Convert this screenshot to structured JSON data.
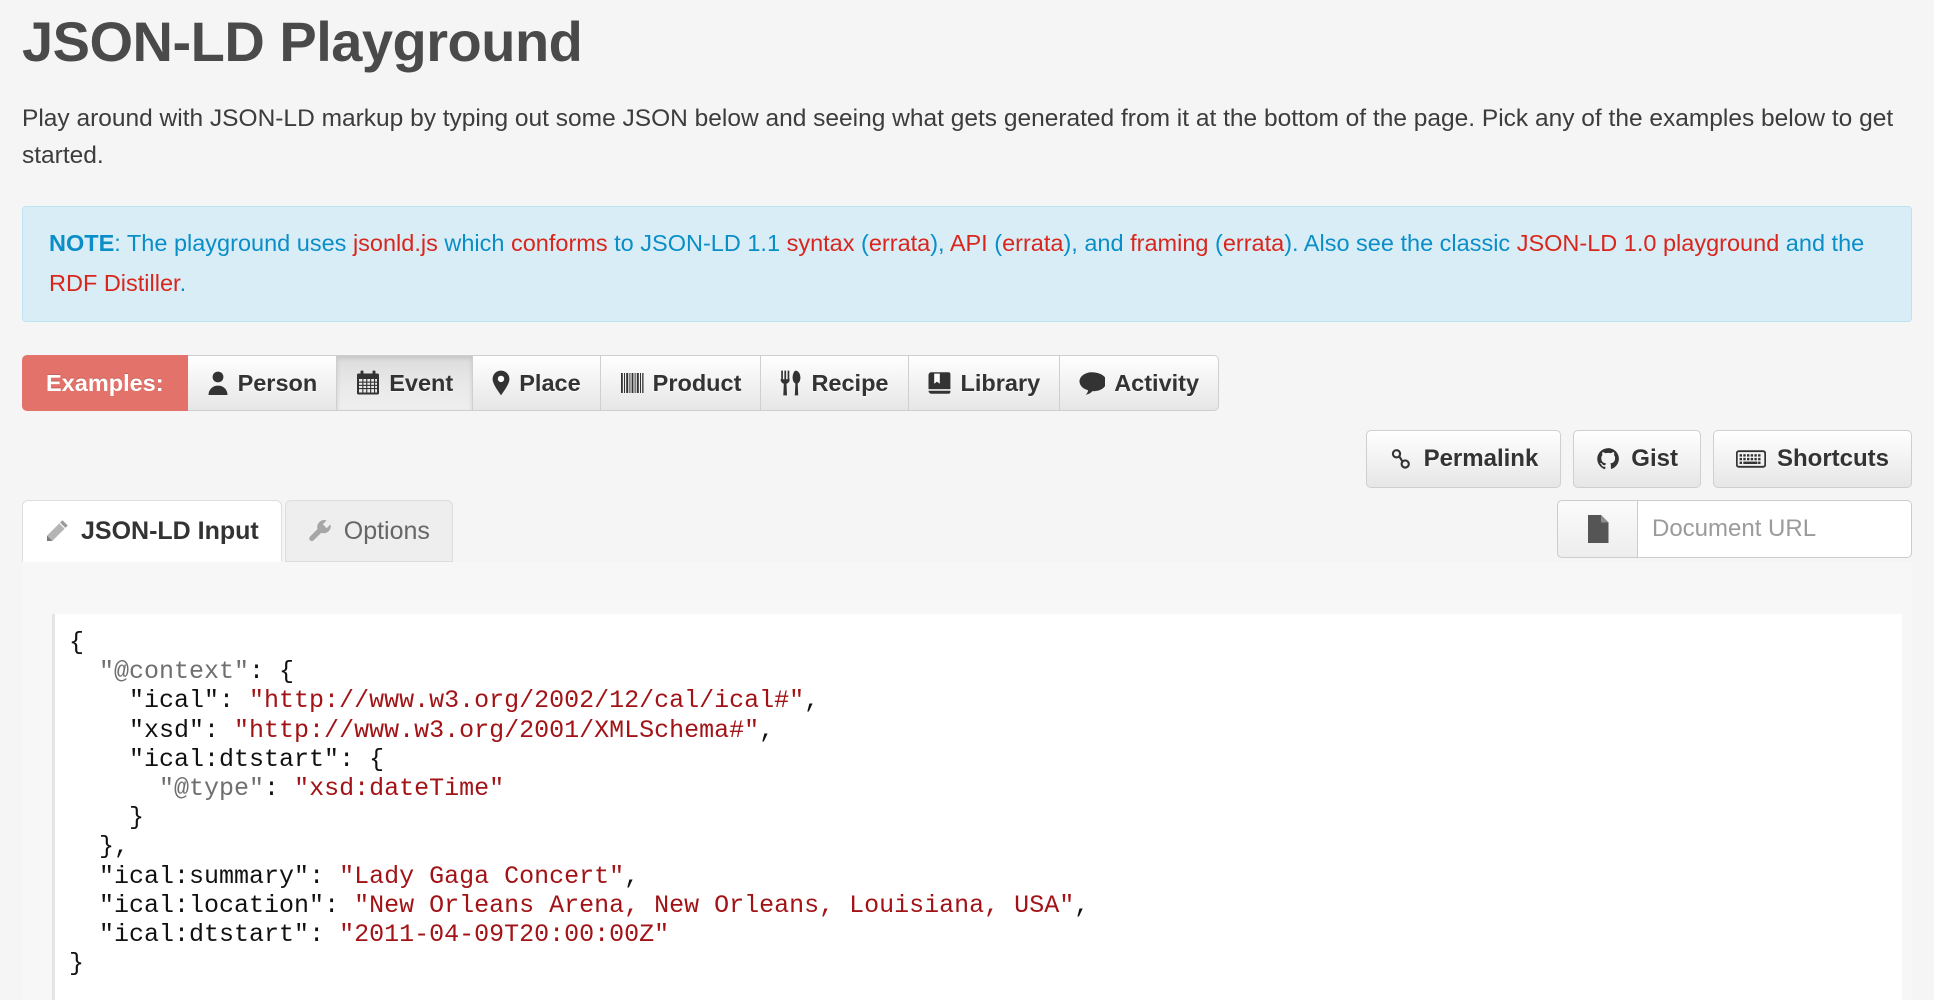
{
  "header": {
    "title": "JSON-LD Playground",
    "intro": "Play around with JSON-LD markup by typing out some JSON below and seeing what gets generated from it at the bottom of the page. Pick any of the examples below to get started."
  },
  "note": {
    "label": "NOTE",
    "colon": ": ",
    "t1": "The playground uses ",
    "l1": "jsonld.js",
    "t2": " which ",
    "l2": "conforms",
    "t3": " to JSON-LD 1.1 ",
    "l3": "syntax",
    "t4": " (",
    "l4": "errata",
    "t5": "), ",
    "l5": "API",
    "t6": " (",
    "l6": "errata",
    "t7": "), and ",
    "l7": "framing",
    "t8": " (",
    "l8": "errata",
    "t9": "). Also see the classic ",
    "l9": "JSON-LD 1.0 playground",
    "t10": " and the ",
    "l10": "RDF Distiller",
    "t11": ".",
    "bg_color": "#d9edf7",
    "text_color": "#0a8ec7",
    "link_color": "#d9261c"
  },
  "examples": {
    "label": "Examples:",
    "label_bg": "#e3726b",
    "items": [
      {
        "label": "Person",
        "icon": "person-icon",
        "active": false
      },
      {
        "label": "Event",
        "icon": "calendar-icon",
        "active": true
      },
      {
        "label": "Place",
        "icon": "map-pin-icon",
        "active": false
      },
      {
        "label": "Product",
        "icon": "barcode-icon",
        "active": false
      },
      {
        "label": "Recipe",
        "icon": "cutlery-icon",
        "active": false
      },
      {
        "label": "Library",
        "icon": "book-icon",
        "active": false
      },
      {
        "label": "Activity",
        "icon": "comment-icon",
        "active": false
      }
    ]
  },
  "actions": [
    {
      "label": "Permalink",
      "icon": "link-icon"
    },
    {
      "label": "Gist",
      "icon": "github-icon"
    },
    {
      "label": "Shortcuts",
      "icon": "keyboard-icon"
    }
  ],
  "document_url": {
    "placeholder": "Document URL",
    "value": "",
    "addon_icon": "file-icon"
  },
  "tabs": [
    {
      "label": "JSON-LD Input",
      "icon": "pencil-icon",
      "active": true
    },
    {
      "label": "Options",
      "icon": "wrench-icon",
      "active": false
    }
  ],
  "editor": {
    "lines": [
      [
        {
          "t": "{",
          "c": "pun"
        }
      ],
      [
        {
          "t": "  ",
          "c": "pun"
        },
        {
          "t": "\"@context\"",
          "c": "at"
        },
        {
          "t": ": {",
          "c": "pun"
        }
      ],
      [
        {
          "t": "    ",
          "c": "pun"
        },
        {
          "t": "\"ical\"",
          "c": "pun"
        },
        {
          "t": ": ",
          "c": "pun"
        },
        {
          "t": "\"http://www.w3.org/2002/12/cal/ical#\"",
          "c": "str"
        },
        {
          "t": ",",
          "c": "pun"
        }
      ],
      [
        {
          "t": "    ",
          "c": "pun"
        },
        {
          "t": "\"xsd\"",
          "c": "pun"
        },
        {
          "t": ": ",
          "c": "pun"
        },
        {
          "t": "\"http://www.w3.org/2001/XMLSchema#\"",
          "c": "str"
        },
        {
          "t": ",",
          "c": "pun"
        }
      ],
      [
        {
          "t": "    ",
          "c": "pun"
        },
        {
          "t": "\"ical:dtstart\"",
          "c": "pun"
        },
        {
          "t": ": {",
          "c": "pun"
        }
      ],
      [
        {
          "t": "      ",
          "c": "pun"
        },
        {
          "t": "\"@type\"",
          "c": "at"
        },
        {
          "t": ": ",
          "c": "pun"
        },
        {
          "t": "\"xsd:dateTime\"",
          "c": "str"
        }
      ],
      [
        {
          "t": "    }",
          "c": "pun"
        }
      ],
      [
        {
          "t": "  },",
          "c": "pun"
        }
      ],
      [
        {
          "t": "  ",
          "c": "pun"
        },
        {
          "t": "\"ical:summary\"",
          "c": "pun"
        },
        {
          "t": ": ",
          "c": "pun"
        },
        {
          "t": "\"Lady Gaga Concert\"",
          "c": "str"
        },
        {
          "t": ",",
          "c": "pun"
        }
      ],
      [
        {
          "t": "  ",
          "c": "pun"
        },
        {
          "t": "\"ical:location\"",
          "c": "pun"
        },
        {
          "t": ": ",
          "c": "pun"
        },
        {
          "t": "\"New Orleans Arena, New Orleans, Louisiana, USA\"",
          "c": "str"
        },
        {
          "t": ",",
          "c": "pun"
        }
      ],
      [
        {
          "t": "  ",
          "c": "pun"
        },
        {
          "t": "\"ical:dtstart\"",
          "c": "pun"
        },
        {
          "t": ": ",
          "c": "pun"
        },
        {
          "t": "\"2011-04-09T20:00:00Z\"",
          "c": "str"
        }
      ],
      [
        {
          "t": "}",
          "c": "pun"
        }
      ]
    ]
  }
}
